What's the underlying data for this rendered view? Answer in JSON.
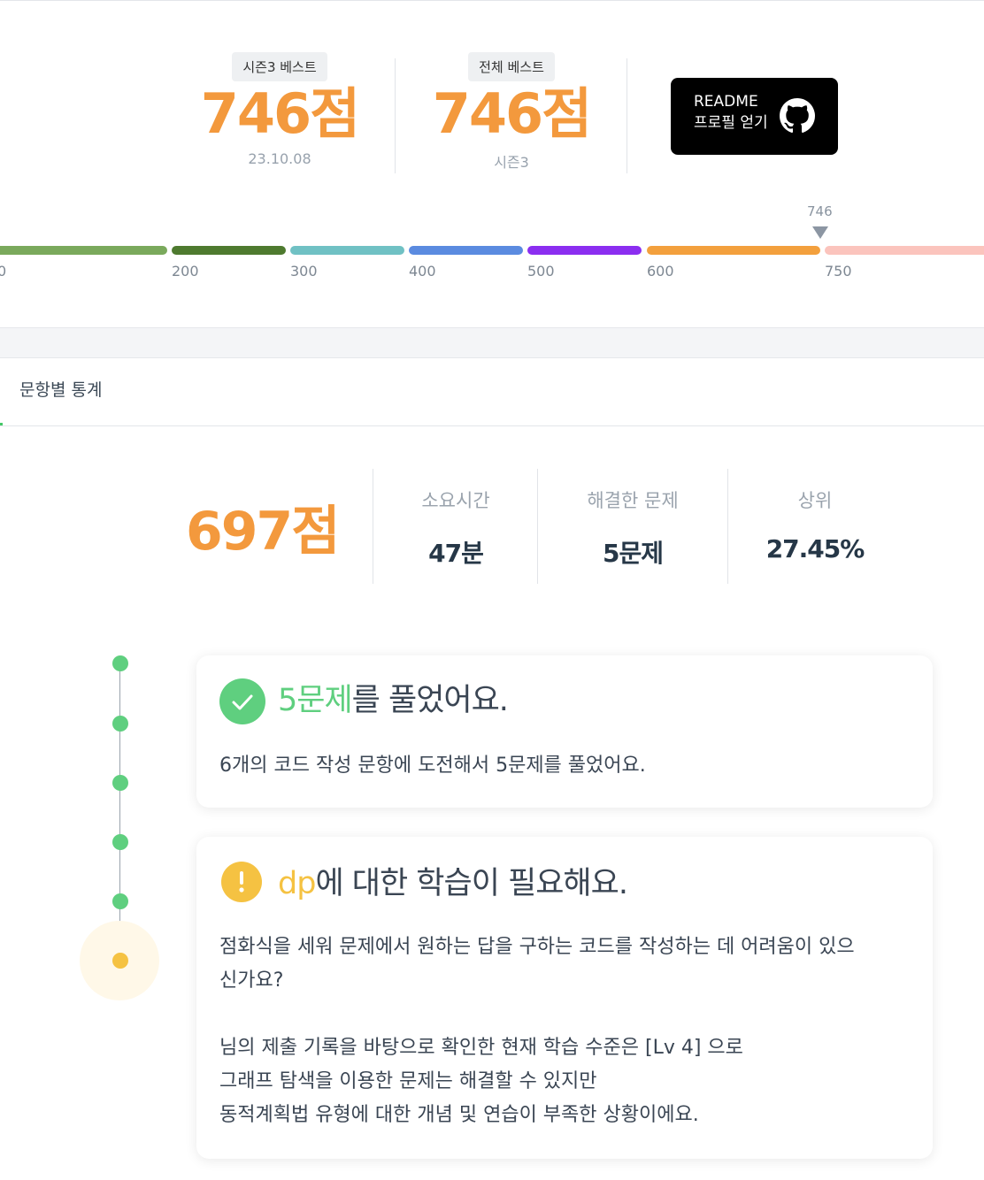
{
  "season_best": {
    "badge": "시즌3 베스트",
    "score": "746점",
    "date": "23.10.08"
  },
  "overall_best": {
    "badge": "전체 베스트",
    "score": "746점",
    "season": "시즌3"
  },
  "readme_button": {
    "line1": "README",
    "line2": "프로필 얻기",
    "icon": "github-icon"
  },
  "level_bar": {
    "ticks": [
      "0",
      "200",
      "300",
      "400",
      "500",
      "600",
      "750"
    ],
    "marker_value": "746",
    "segment_colors": [
      "#7aa95c",
      "#4e7a2f",
      "#70c1c4",
      "#5b8be0",
      "#8b2ef0",
      "#f3a03d",
      "#fbc4bd"
    ]
  },
  "tabs": {
    "active_label": "문항별 통계"
  },
  "stats": {
    "score": "697점",
    "time": {
      "label": "소요시간",
      "value": "47분"
    },
    "solved": {
      "label": "해결한 문제",
      "value": "5문제"
    },
    "rank": {
      "label": "상위",
      "value": "27.45%"
    }
  },
  "card_solved": {
    "icon": "check-icon",
    "highlight": "5문제",
    "title_rest": "를 풀었어요.",
    "body": "6개의 코드 작성 문항에 도전해서 5문제를 풀었어요."
  },
  "card_dp": {
    "icon": "exclamation-icon",
    "highlight": "dp",
    "title_rest": "에 대한 학습이 필요해요.",
    "question_line1": "점화식을 세워 문제에서 원하는 답을 구하는 코드를 작성하는 데 어려움이 있으",
    "question_line2": "신가요?",
    "detail_line1": "님의 제출 기록을 바탕으로 확인한 현재 학습 수준은 [Lv 4] 으로",
    "detail_line2": "그래프 탐색을 이용한 문제는 해결할 수 있지만",
    "detail_line3": "동적계획법 유형에 대한 개념 및 연습이 부족한 상황이에요."
  },
  "colors": {
    "accent_orange": "#f3993d",
    "success_green": "#5fcf7f",
    "warning_yellow": "#f5c242"
  }
}
